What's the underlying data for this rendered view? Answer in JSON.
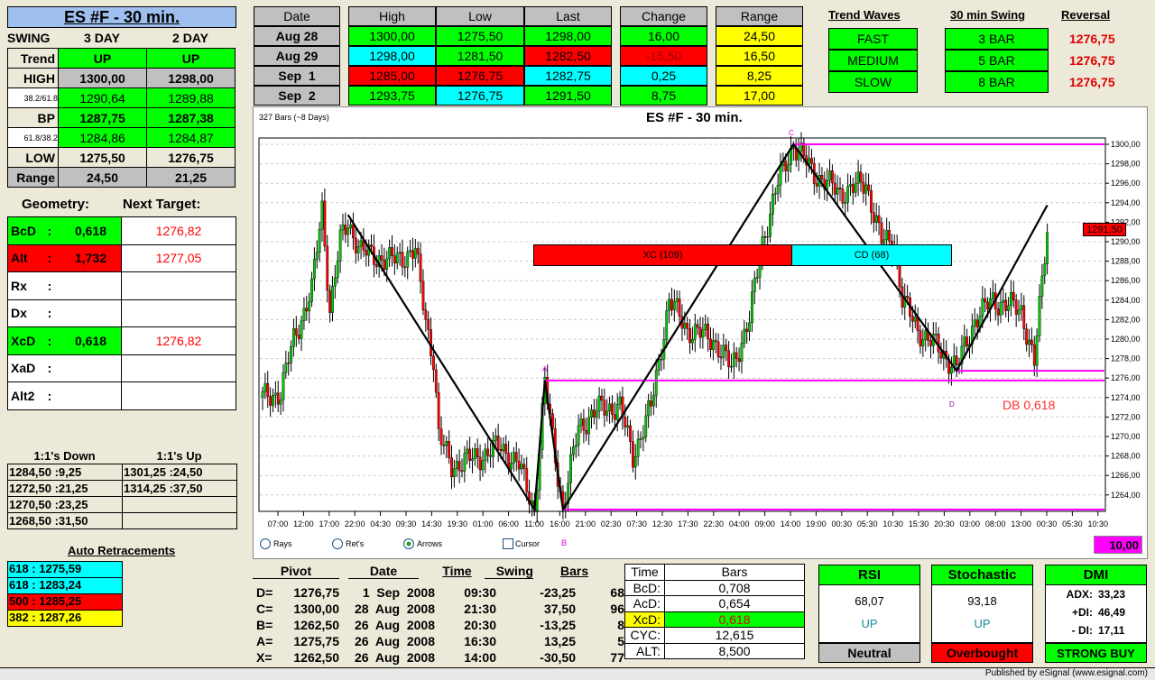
{
  "title": "ES #F - 30 min.",
  "swing": {
    "label": "SWING",
    "cols": [
      "3 DAY",
      "2 DAY"
    ],
    "rows": [
      {
        "label": "Trend",
        "v": [
          "UP",
          "UP"
        ]
      },
      {
        "label": "HIGH",
        "v": [
          "1300,00",
          "1298,00"
        ]
      },
      {
        "label": "38.2/61.8",
        "v": [
          "1290,64",
          "1289,88"
        ]
      },
      {
        "label": "BP",
        "v": [
          "1287,75",
          "1287,38"
        ]
      },
      {
        "label": "61.8/38.2",
        "v": [
          "1284,86",
          "1284,87"
        ]
      },
      {
        "label": "LOW",
        "v": [
          "1275,50",
          "1276,75"
        ]
      },
      {
        "label": "Range",
        "v": [
          "24,50",
          "21,25"
        ]
      }
    ]
  },
  "geometry": {
    "label": "Geometry:",
    "next_label": "Next Target:",
    "rows": [
      {
        "name": "BcD",
        "sep": ":",
        "val": "0,618",
        "target": "1276,82"
      },
      {
        "name": "Alt",
        "sep": ":",
        "val": "1,732",
        "target": "1277,05"
      },
      {
        "name": "Rx",
        "sep": ":",
        "val": "",
        "target": ""
      },
      {
        "name": "Dx",
        "sep": ":",
        "val": "",
        "target": ""
      },
      {
        "name": "XcD",
        "sep": ":",
        "val": "0,618",
        "target": "1276,82"
      },
      {
        "name": "XaD",
        "sep": ":",
        "val": "",
        "target": ""
      },
      {
        "name": "Alt2",
        "sep": ":",
        "val": "",
        "target": ""
      }
    ]
  },
  "ones": {
    "down_label": "1:1's Down",
    "up_label": "1:1's Up",
    "down": [
      "1284,50 :9,25",
      "1272,50 :21,25",
      "1270,50 :23,25",
      "1268,50 :31,50"
    ],
    "up": [
      "1301,25 :24,50",
      "1314,25 :37,50",
      "",
      ""
    ]
  },
  "retracements": {
    "label": "Auto Retracements",
    "items": [
      "618 : 1275,59",
      "618 : 1283,24",
      "500 : 1285,25",
      "382 : 1287,26"
    ]
  },
  "daily": {
    "headers": [
      "Date",
      "High",
      "Low",
      "Last",
      "Change",
      "Range"
    ],
    "rows": [
      {
        "date": "Aug 28",
        "high": "1300,00",
        "low": "1275,50",
        "last": "1298,00",
        "change": "16,00",
        "range": "24,50"
      },
      {
        "date": "Aug 29",
        "high": "1298,00",
        "low": "1281,50",
        "last": "1282,50",
        "change": "-15,50",
        "range": "16,50"
      },
      {
        "date": "Sep  1",
        "high": "1285,00",
        "low": "1276,75",
        "last": "1282,75",
        "change": "0,25",
        "range": "8,25"
      },
      {
        "date": "Sep  2",
        "high": "1293,75",
        "low": "1276,75",
        "last": "1291,50",
        "change": "8,75",
        "range": "17,00"
      }
    ]
  },
  "waves": {
    "trend_label": "Trend Waves",
    "swing_label": "30 min Swing",
    "reversal_label": "Reversal",
    "rows": [
      {
        "wave": "FAST",
        "swing": "3 BAR",
        "rev": "1276,75"
      },
      {
        "wave": "MEDIUM",
        "swing": "5 BAR",
        "rev": "1276,75"
      },
      {
        "wave": "SLOW",
        "swing": "8 BAR",
        "rev": "1276,75"
      }
    ]
  },
  "chart": {
    "bars_label": "327 Bars (~8 Days)",
    "title": "ES #F - 30 min.",
    "last_price": "1291,50",
    "xc": "XC (109)",
    "cd": "CD (68)",
    "db": "DB 0,618",
    "pivots": {
      "A": "A",
      "B": "B",
      "C": "C",
      "D": "D"
    },
    "options": [
      {
        "label": "Rays",
        "checked": false
      },
      {
        "label": "Ret's",
        "checked": false
      },
      {
        "label": "Arrows",
        "checked": true
      }
    ],
    "cursor_label": "Cursor",
    "value_box": "10,00"
  },
  "chart_data": {
    "type": "candlestick",
    "ylim": [
      1262,
      1301
    ],
    "yticks": [
      "1300,00",
      "1298,00",
      "1296,00",
      "1294,00",
      "1292,00",
      "1290,00",
      "1288,00",
      "1286,00",
      "1284,00",
      "1282,00",
      "1280,00",
      "1278,00",
      "1276,00",
      "1274,00",
      "1272,00",
      "1270,00",
      "1268,00",
      "1266,00",
      "1264,00"
    ],
    "xticks": [
      "07:00",
      "12:00",
      "17:00",
      "22:00",
      "04:30",
      "09:30",
      "14:30",
      "19:30",
      "01:00",
      "06:00",
      "11:00",
      "16:00",
      "21:00",
      "02:30",
      "07:30",
      "12:30",
      "17:30",
      "22:30",
      "04:00",
      "09:00",
      "14:00",
      "19:00",
      "00:30",
      "05:30",
      "10:30",
      "15:30",
      "20:30",
      "03:00",
      "08:00",
      "13:00",
      "00:30",
      "05:30",
      "10:30"
    ],
    "price_path": [
      [
        0,
        1274
      ],
      [
        7,
        1274.5
      ],
      [
        12,
        1280
      ],
      [
        19,
        1285
      ],
      [
        23,
        1293.5
      ],
      [
        26,
        1283
      ],
      [
        30,
        1290
      ],
      [
        33,
        1292
      ],
      [
        38,
        1289
      ],
      [
        49,
        1288
      ],
      [
        59,
        1289
      ],
      [
        63,
        1282
      ],
      [
        66,
        1278
      ],
      [
        68,
        1270
      ],
      [
        73,
        1267
      ],
      [
        84,
        1268
      ],
      [
        92,
        1269
      ],
      [
        99,
        1267
      ],
      [
        105,
        1262.5
      ],
      [
        109,
        1275.5
      ],
      [
        113,
        1268
      ],
      [
        116,
        1262.5
      ],
      [
        122,
        1271
      ],
      [
        131,
        1273
      ],
      [
        138,
        1273
      ],
      [
        143,
        1268
      ],
      [
        150,
        1273
      ],
      [
        157,
        1284
      ],
      [
        164,
        1281
      ],
      [
        174,
        1280
      ],
      [
        181,
        1277
      ],
      [
        188,
        1282
      ],
      [
        193,
        1290
      ],
      [
        199,
        1296
      ],
      [
        205,
        1300
      ],
      [
        213,
        1297
      ],
      [
        223,
        1295
      ],
      [
        233,
        1296
      ],
      [
        239,
        1290
      ],
      [
        244,
        1290
      ],
      [
        247,
        1284
      ],
      [
        253,
        1281
      ],
      [
        261,
        1279
      ],
      [
        268,
        1277
      ],
      [
        275,
        1282
      ],
      [
        282,
        1284
      ],
      [
        293,
        1283
      ],
      [
        298,
        1277.5
      ],
      [
        303,
        1291.5
      ]
    ],
    "zigzag": [
      [
        33,
        1292.75
      ],
      [
        105,
        1262.5
      ],
      [
        109,
        1275.75
      ],
      [
        116,
        1262.5
      ],
      [
        205,
        1300
      ],
      [
        268,
        1276.75
      ],
      [
        303,
        1293.75
      ]
    ],
    "levels": [
      {
        "from": 205,
        "price": 1300
      },
      {
        "from": 109,
        "price": 1275.75
      },
      {
        "from": 268,
        "price": 1276.75
      },
      {
        "from": 116,
        "price": 1262.5
      }
    ]
  },
  "pivot_table": {
    "headers": [
      "Pivot",
      "Date",
      "Time",
      "Swing",
      "Bars"
    ],
    "rows": [
      [
        "D=",
        "1276,75",
        "1  Sep  2008",
        "09:30",
        "-23,25",
        "68"
      ],
      [
        "C=",
        "1300,00",
        "28  Aug  2008",
        "21:30",
        "37,50",
        "96"
      ],
      [
        "B=",
        "1262,50",
        "26  Aug  2008",
        "20:30",
        "-13,25",
        "8"
      ],
      [
        "A=",
        "1275,75",
        "26  Aug  2008",
        "16:30",
        "13,25",
        "5"
      ],
      [
        "X=",
        "1262,50",
        "26  Aug  2008",
        "14:00",
        "-30,50",
        "77"
      ]
    ]
  },
  "time_bars": {
    "headers": [
      "Time",
      "Bars"
    ],
    "rows": [
      [
        "BcD:",
        "0,708"
      ],
      [
        "AcD:",
        "0,654"
      ],
      [
        "XcD:",
        "0,618"
      ],
      [
        "CYC:",
        "12,615"
      ],
      [
        "ALT:",
        "8,500"
      ]
    ]
  },
  "rsi": {
    "label": "RSI",
    "value": "68,07",
    "dir": "UP",
    "status": "Neutral"
  },
  "stoch": {
    "label": "Stochastic",
    "value": "93,18",
    "dir": "UP",
    "status": "Overbought"
  },
  "dmi": {
    "label": "DMI",
    "adx_label": "ADX:",
    "adx": "33,23",
    "pdi_label": "+DI:",
    "pdi": "46,49",
    "mdi_label": "- DI:",
    "mdi": "17,11",
    "status": "STRONG BUY"
  },
  "footer": "Published by eSignal (www.esignal.com)"
}
